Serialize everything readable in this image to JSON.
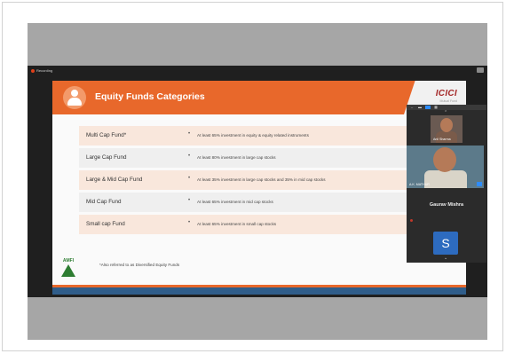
{
  "meeting": {
    "recording_label": "Recording"
  },
  "slide": {
    "title": "Equity Funds Categories",
    "logo_text": "ICICI",
    "logo_sub": "Mutual Fund",
    "rows": [
      {
        "name": "Multi Cap Fund*",
        "bullet": "•",
        "desc": "At least 65% investment in equity & equity related instruments"
      },
      {
        "name": "Large Cap Fund",
        "bullet": "•",
        "desc": "At least 80% investment in large cap stocks"
      },
      {
        "name": "Large & Mid Cap Fund",
        "bullet": "•",
        "desc": "At least 35% investment in large cap stocks and 35% in mid cap stocks"
      },
      {
        "name": "Mid Cap Fund",
        "bullet": "•",
        "desc": "At least 65% investment in mid cap stocks"
      },
      {
        "name": "Small cap Fund",
        "bullet": "•",
        "desc": "At least 65% investment in small cap stocks"
      }
    ],
    "footnote": "*Also referred to as Diversified Equity Funds",
    "amfi_text": "AMFI"
  },
  "participants": {
    "tiles": [
      {
        "name": "Anil Sharma"
      },
      {
        "name": "A.K. MATHUR"
      }
    ],
    "active_speaker": "Gaurav Mishra",
    "avatar_initial": "S"
  },
  "colors": {
    "accent": "#e8682b",
    "zoom_blue": "#2d8cff"
  }
}
